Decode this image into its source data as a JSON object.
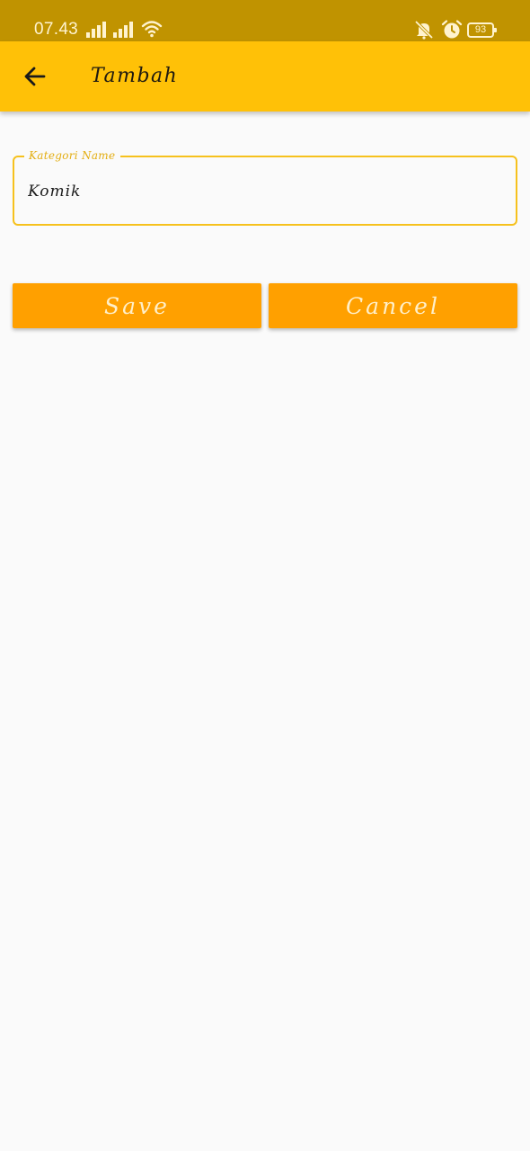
{
  "status_bar": {
    "time": "07.43",
    "battery": "93",
    "icons": [
      "signal-icon",
      "signal-icon",
      "wifi-icon",
      "mute-icon",
      "alarm-icon",
      "battery-icon"
    ]
  },
  "app_bar": {
    "title": "Tambah",
    "back_icon": "arrow-back-icon"
  },
  "form": {
    "category_field": {
      "label": "Kategori Name",
      "value": "Komik"
    },
    "save_label": "Save",
    "cancel_label": "Cancel"
  },
  "colors": {
    "status_bar": "#C09300",
    "app_bar": "#FFC107",
    "field_border": "#F6C11D",
    "button": "#FFA000",
    "background": "#FAFAFA"
  }
}
